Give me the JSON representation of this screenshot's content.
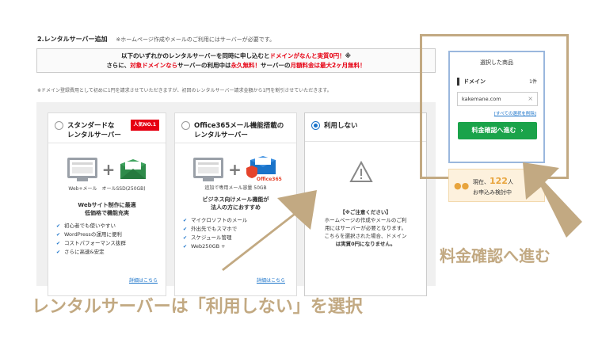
{
  "section": {
    "title": "2.レンタルサーバー追加",
    "note": "※ホームページ作成やメールのご利用にはサーバーが必要です。"
  },
  "promo": {
    "line1_a": "以下のいずれかのレンタルサーバーを同時に申し込むと",
    "line1_red": "ドメインがなんと実質0円！",
    "line1_b": "※",
    "line2_a": "さらに、",
    "line2_red1": "対象ドメインなら",
    "line2_b": "サーバーの利用中は",
    "line2_red2": "永久無料！",
    "line2_c": "サーバーの",
    "line2_red3": "月額料金は最大2ヶ月無料！"
  },
  "disclaimer": "※ドメイン登録費用として初めに1円を請求させていただきますが、初回のレンタルサーバー請求金額から1円を割引させていただきます。",
  "plans": [
    {
      "name_line1": "スタンダードな",
      "name_line2": "レンタルサーバー",
      "badge": "人気NO.1",
      "icon_caption": "Web+メール　オールSSD(250GB)",
      "headline1": "Webサイト制作に最適",
      "headline2": "低価格で機能充実",
      "features": [
        "初心者でも使いやすい",
        "WordPressの運用に便利",
        "コストパフォーマンス抜群",
        "さらに高速&安定"
      ],
      "link": "詳細はこちら"
    },
    {
      "name_line1": "Office365メール機能搭載の",
      "name_line2": "レンタルサーバー",
      "icon_label": "Office365",
      "icon_caption": "追加で専用メール容量 50GB",
      "headline1": "ビジネス向けメール機能が",
      "headline2": "法人の方におすすめ",
      "features": [
        "マイクロソフトのメール",
        "外出先でもスマホで",
        "スケジュール管理",
        "Web250GB +"
      ],
      "link": "詳細はこちら"
    },
    {
      "name_line1": "利用しない",
      "warning_title": "【※ご注意ください】",
      "warning_l1": "ホームページの作成やメールのご利",
      "warning_l2": "用にはサーバーが必要となります。",
      "warning_l3": "こちらを選択された場合、ドメイン",
      "warning_l4": "は実質0円になりません。"
    }
  ],
  "sidebar": {
    "title": "選択した商品",
    "domain_label": "ドメイン",
    "domain_count": "1件",
    "domain_value": "kakemane.com",
    "clear_link": "[すべての選択を削除]",
    "confirm_button": "料金確認へ進む"
  },
  "now_box": {
    "line1_a": "現在、",
    "line1_num": "122",
    "line1_b": "人",
    "line2": "お申込み検討中"
  },
  "annotations": {
    "right_caption": "料金確認へ進む",
    "bottom_caption": "レンタルサーバーは「利用しない」を選択"
  },
  "colors": {
    "accent_red": "#e60012",
    "accent_blue": "#1a73c9",
    "button_green": "#1aa34a",
    "annotation_gold": "#c2a982"
  }
}
